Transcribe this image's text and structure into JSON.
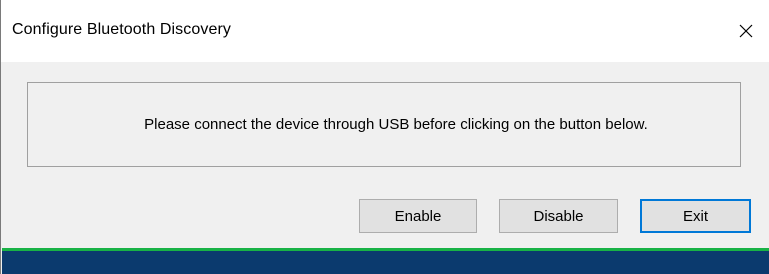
{
  "window": {
    "title": "Configure Bluetooth Discovery",
    "close_glyph": "×"
  },
  "message": {
    "text": "Please connect the device through USB before clicking on the button below."
  },
  "buttons": {
    "enable_label": "Enable",
    "disable_label": "Disable",
    "exit_label": "Exit",
    "default_button": "Exit"
  },
  "icons": {
    "close": "close-icon"
  },
  "colors": {
    "titlebar_bg": "#ffffff",
    "window_bg": "#f0f0f0",
    "button_bg": "#e1e1e1",
    "focus_border": "#0078d7",
    "accent_green": "#19b246",
    "bottom_bar": "#0b3a6e"
  }
}
